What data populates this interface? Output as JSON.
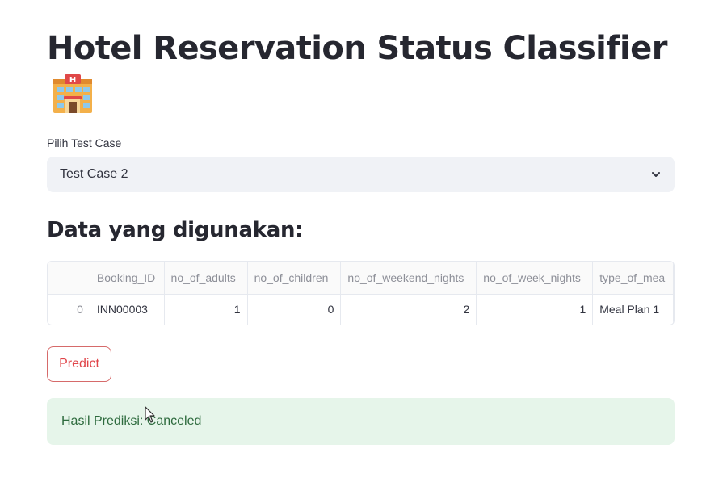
{
  "page": {
    "title": "Hotel Reservation Status Classifier",
    "title_icon": "hotel-emoji-icon"
  },
  "select": {
    "label": "Pilih Test Case",
    "value": "Test Case 2",
    "icon": "chevron-down-icon"
  },
  "data_section": {
    "heading": "Data yang digunakan:",
    "columns": [
      "",
      "Booking_ID",
      "no_of_adults",
      "no_of_children",
      "no_of_weekend_nights",
      "no_of_week_nights",
      "type_of_mea"
    ],
    "rows": [
      [
        "0",
        "INN00003",
        "1",
        "0",
        "2",
        "1",
        "Meal Plan 1"
      ]
    ]
  },
  "predict": {
    "label": "Predict"
  },
  "result": {
    "text": "Hasil Prediksi: Canceled"
  },
  "colors": {
    "primary": "#ff4b4b",
    "select_bg": "#f0f2f6",
    "success_bg": "#e6f5ea",
    "success_text": "#2e6b3e"
  }
}
